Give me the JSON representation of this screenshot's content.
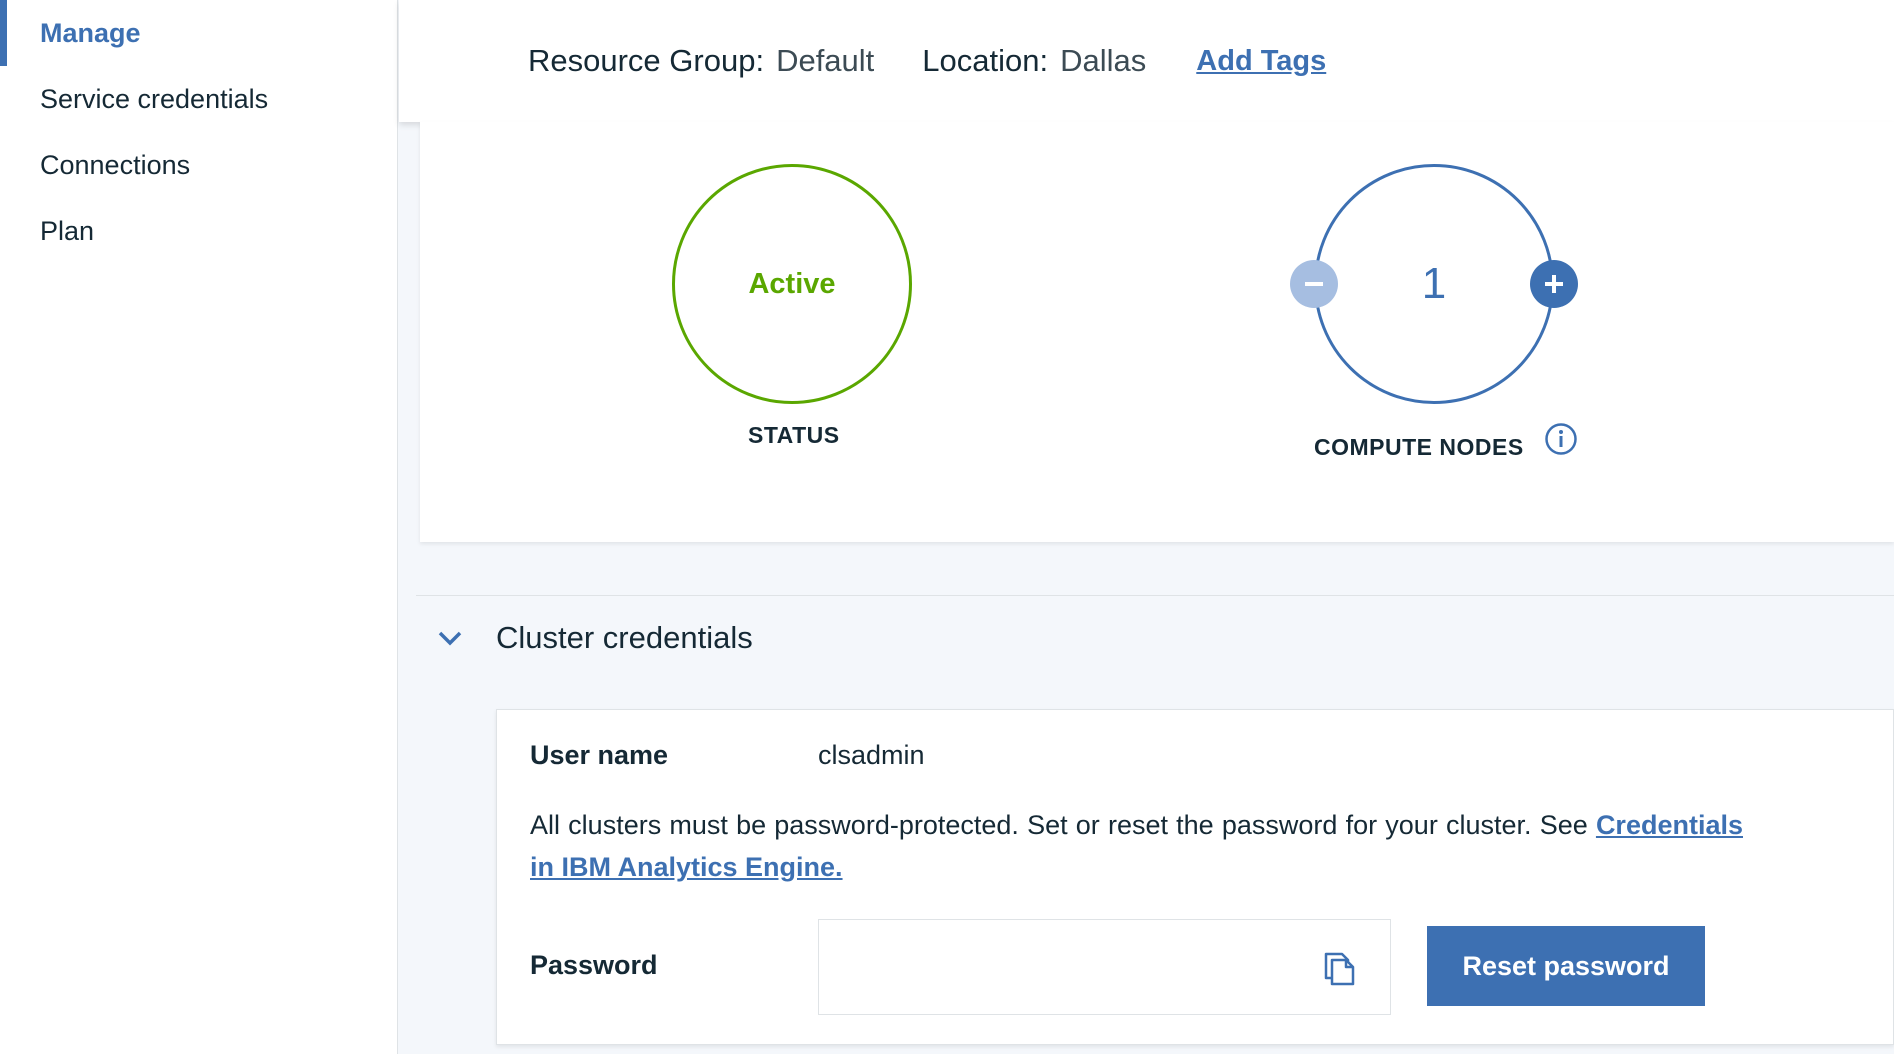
{
  "sidebar": {
    "items": [
      {
        "label": "Manage",
        "active": true
      },
      {
        "label": "Service credentials",
        "active": false
      },
      {
        "label": "Connections",
        "active": false
      },
      {
        "label": "Plan",
        "active": false
      }
    ]
  },
  "info_bar": {
    "resource_group_label": "Resource Group:",
    "resource_group_value": "Default",
    "location_label": "Location:",
    "location_value": "Dallas",
    "add_tags_label": "Add Tags"
  },
  "status": {
    "value": "Active",
    "caption": "STATUS",
    "color": "#5aa700"
  },
  "compute_nodes": {
    "value": "1",
    "caption": "COMPUTE NODES",
    "decrement_icon": "minus-icon",
    "increment_icon": "plus-icon",
    "info_icon": "info-icon",
    "color": "#3d70b2"
  },
  "cluster_credentials": {
    "title": "Cluster credentials",
    "expanded": true,
    "username_label": "User name",
    "username_value": "clsadmin",
    "description": "All clusters must be password-protected. Set or reset the password for your cluster. See",
    "description_link": "Credentials in IBM Analytics Engine.",
    "password_label": "Password",
    "password_value": "",
    "copy_icon": "copy-icon",
    "reset_button_label": "Reset password"
  },
  "colors": {
    "accent": "#3d70b2",
    "success": "#5aa700",
    "disabled_button": "#a6bee1"
  }
}
